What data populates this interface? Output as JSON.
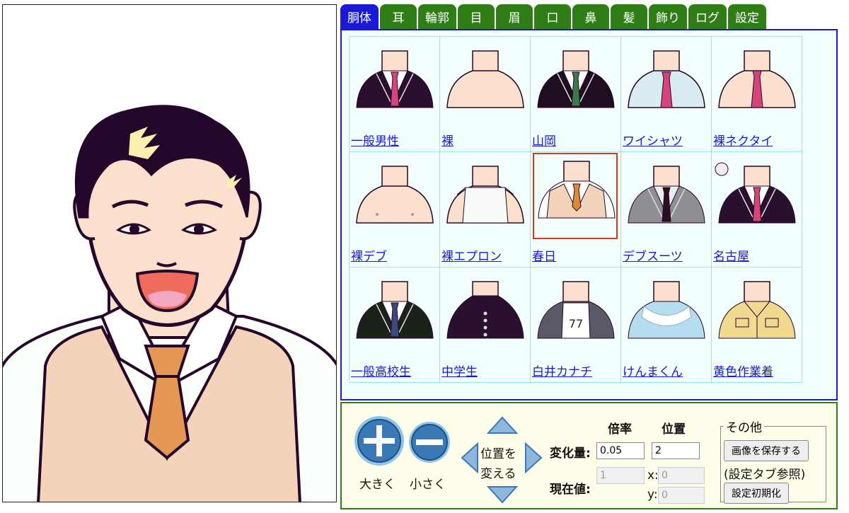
{
  "tabs": [
    "胴体",
    "耳",
    "輪郭",
    "目",
    "眉",
    "口",
    "鼻",
    "髪",
    "飾り",
    "ログ",
    "設定"
  ],
  "active_tab": "胴体",
  "body_items": [
    {
      "label": "一般男性",
      "style": "blazer",
      "jacket": "#2a0f2e",
      "tie": "#d6457a",
      "shirt": "#fff"
    },
    {
      "label": "裸",
      "style": "bare"
    },
    {
      "label": "山岡",
      "style": "blazer",
      "jacket": "#1f0d20",
      "tie": "#3a7a4a",
      "shirt": "#fff"
    },
    {
      "label": "ワイシャツ",
      "style": "shirt",
      "tie": "#d6457a",
      "shirt": "#d8ecf2"
    },
    {
      "label": "裸ネクタイ",
      "style": "bare-tie",
      "tie": "#d6457a"
    },
    {
      "label": "裸デブ",
      "style": "bare-fat"
    },
    {
      "label": "裸エプロン",
      "style": "apron"
    },
    {
      "label": "春日",
      "style": "vest",
      "tie": "#e08a34",
      "selected": true
    },
    {
      "label": "デブスーツ",
      "style": "blazer",
      "jacket": "#8f8f93",
      "tie": "#2a0f1e",
      "shirt": "#e9eef3"
    },
    {
      "label": "名古屋",
      "style": "blazer",
      "jacket": "#2a0f2e",
      "tie": "#d6457a",
      "shirt": "#fff",
      "badge": true
    },
    {
      "label": "一般高校生",
      "style": "blazer",
      "jacket": "#1a2219",
      "tie": "#3a4a7a",
      "shirt": "#fff"
    },
    {
      "label": "中学生",
      "style": "gakuran",
      "jacket": "#2a0f2e"
    },
    {
      "label": "白井カナチ",
      "style": "hoodie",
      "jacket": "#5a5a66",
      "shirt": "#fff",
      "number": "77"
    },
    {
      "label": "けんまくん",
      "style": "fur",
      "jacket": "#b6dcef"
    },
    {
      "label": "黄色作業着",
      "style": "work",
      "jacket": "#f1d98f"
    }
  ],
  "controls": {
    "bigger_label": "大きく",
    "smaller_label": "小さく",
    "move_label_1": "位置を",
    "move_label_2": "変える",
    "col_scale": "倍率",
    "col_pos": "位置",
    "delta_label": "変化量:",
    "current_label": "現在値:",
    "delta_scale": "0.05",
    "delta_pos": "2",
    "current_scale": "1",
    "x_label": "x:",
    "y_label": "y:",
    "x_value": "0",
    "y_value": "0"
  },
  "other": {
    "legend": "その他",
    "save_button": "画像を保存する",
    "note": "(設定タブ参照)",
    "reset_button": "設定初期化"
  },
  "colors": {
    "tab_active": "#1a1ad6",
    "tab": "#2f7d17",
    "vest": "#f4d3bb",
    "tie": "#e59854",
    "hair": "#24072a",
    "skin": "#fbe1cd"
  }
}
